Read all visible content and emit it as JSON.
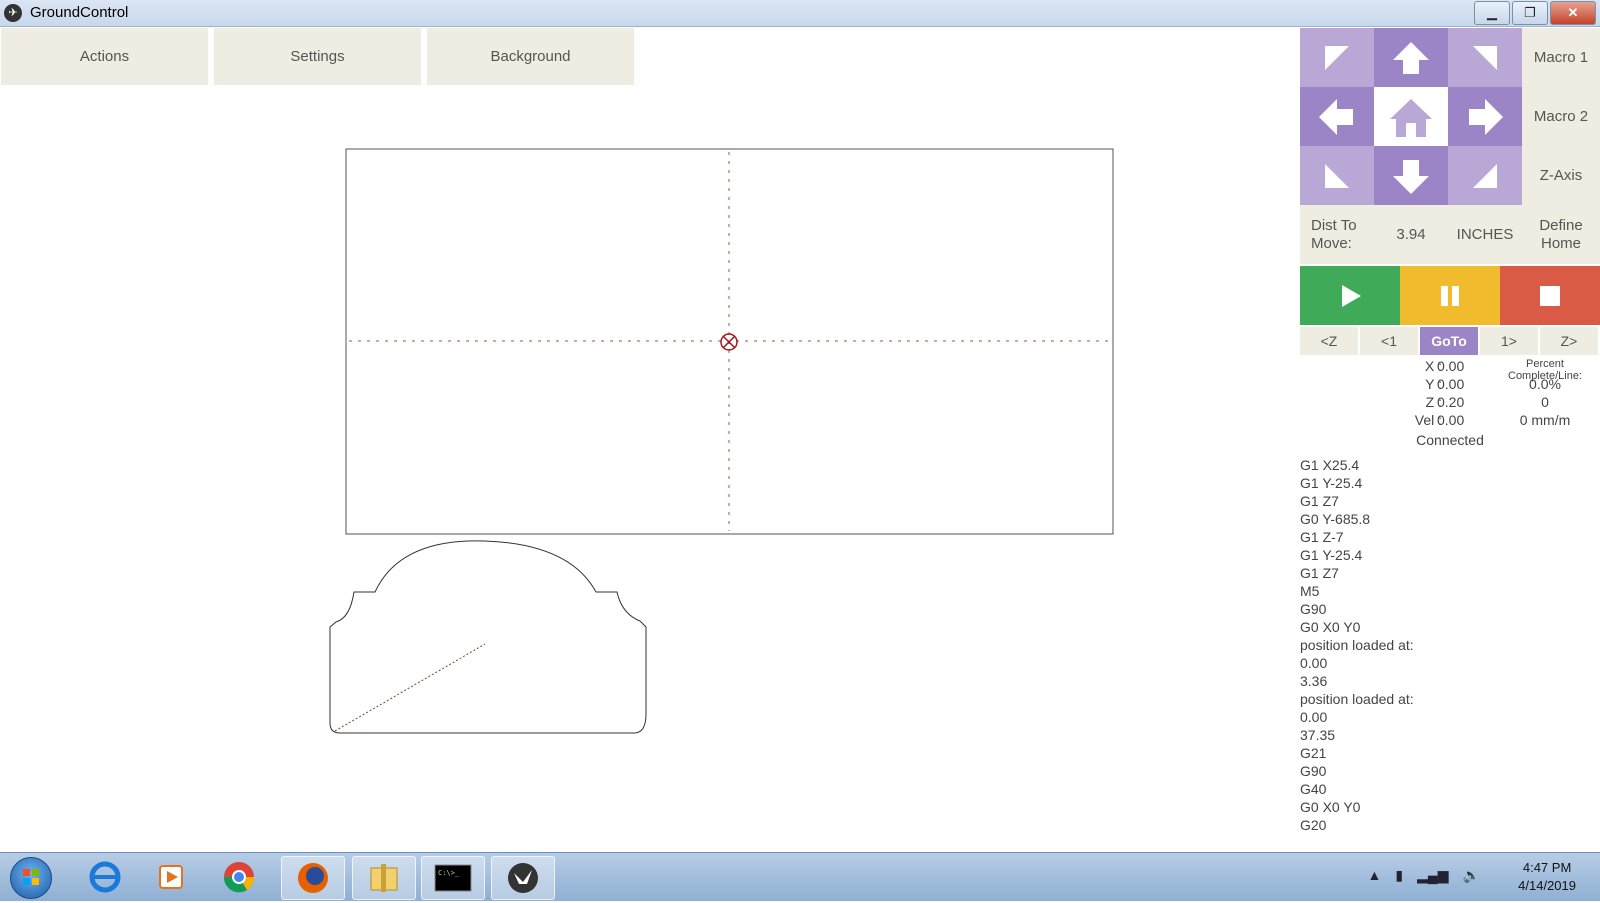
{
  "window": {
    "title": "GroundControl"
  },
  "menu": {
    "tabs": [
      "Actions",
      "Settings",
      "Background"
    ]
  },
  "jog": {
    "macro1": "Macro 1",
    "macro2": "Macro 2",
    "zaxis": "Z-Axis",
    "dist_label": "Dist To Move:",
    "dist_value": "3.94",
    "units": "INCHES",
    "define_home": "Define Home"
  },
  "steps": [
    "<Z",
    "<1",
    "GoTo",
    "1>",
    "Z>"
  ],
  "position": {
    "x_label": "X :",
    "x": "0.00",
    "y_label": "Y :",
    "y": "0.00",
    "z_label": "Z :",
    "z": "0.20",
    "vel_label": "Vel :",
    "vel": "0.00",
    "percent_label": "Percent Complete/Line:",
    "percent": "0.0%",
    "line": "0",
    "rate": "0 mm/m"
  },
  "status": "Connected",
  "console_lines": [
    "G1 X25.4",
    "G1 Y-25.4",
    "G1 Z7",
    "G0 Y-685.8",
    "G1 Z-7",
    "G1 Y-25.4",
    "G1 Z7",
    "M5",
    "G90",
    "G0 X0 Y0",
    "position loaded at:",
    "0.00",
    "3.36",
    "position loaded at:",
    "0.00",
    "37.35",
    "G21",
    "G90",
    "G40",
    "G0 X0 Y0",
    "G20"
  ],
  "taskbar": {
    "time": "4:47 PM",
    "date": "4/14/2019"
  },
  "icons": {
    "app": "groundcontrol-icon",
    "jog": [
      "up-left-arrow-icon",
      "up-arrow-icon",
      "up-right-arrow-icon",
      "left-arrow-icon",
      "home-icon",
      "right-arrow-icon",
      "down-left-arrow-icon",
      "down-arrow-icon",
      "down-right-arrow-icon"
    ],
    "run": [
      "play-icon",
      "pause-icon",
      "stop-icon"
    ]
  },
  "colors": {
    "purple_light": "#b9a8d6",
    "purple_dark": "#9b85c6",
    "play": "#3faa58",
    "pause": "#f0bc2e",
    "stop": "#d95b45",
    "menu_bg": "#efede2"
  }
}
